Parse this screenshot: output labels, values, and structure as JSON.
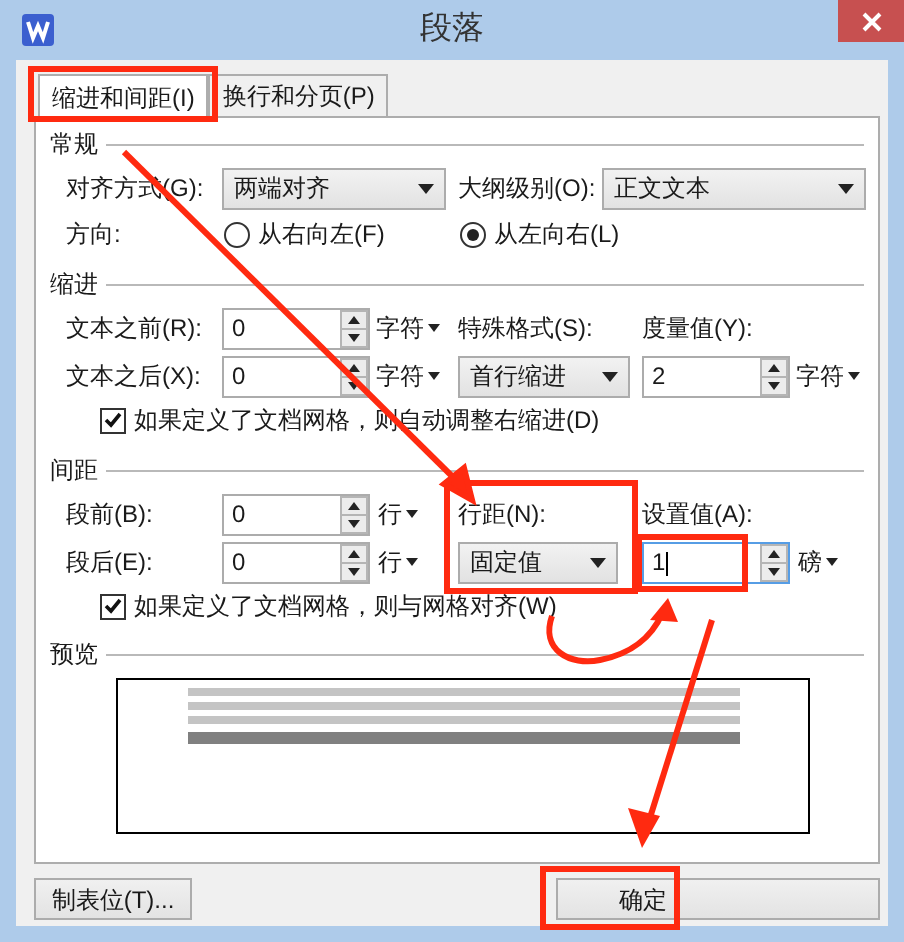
{
  "window": {
    "title": "段落"
  },
  "tabs": [
    {
      "label": "缩进和间距(I)",
      "selected": true,
      "highlighted": true
    },
    {
      "label": "换行和分页(P)",
      "selected": false,
      "highlighted": false
    }
  ],
  "general": {
    "heading": "常规",
    "alignment": {
      "label": "对齐方式(G):",
      "value": "两端对齐"
    },
    "outline_level": {
      "label": "大纲级别(O):",
      "value": "正文文本"
    },
    "direction": {
      "label": "方向:",
      "options": [
        {
          "label": "从右向左(F)",
          "selected": false
        },
        {
          "label": "从左向右(L)",
          "selected": true
        }
      ]
    }
  },
  "indent": {
    "heading": "缩进",
    "rows": [
      {
        "label": "文本之前(R):",
        "value": "0",
        "unit": "字符"
      },
      {
        "label": "文本之后(X):",
        "value": "0",
        "unit": "字符"
      }
    ],
    "special": {
      "label": "特殊格式(S):",
      "value": "首行缩进"
    },
    "measure": {
      "label": "度量值(Y):",
      "value": "2",
      "unit": "字符"
    },
    "auto_adjust": {
      "label": "如果定义了文档网格，则自动调整右缩进(D)",
      "checked": true
    }
  },
  "spacing": {
    "heading": "间距",
    "rows": [
      {
        "label": "段前(B):",
        "value": "0",
        "unit": "行"
      },
      {
        "label": "段后(E):",
        "value": "0",
        "unit": "行"
      }
    ],
    "line_spacing": {
      "label": "行距(N):",
      "value": "固定值",
      "highlighted": true
    },
    "set_value": {
      "label": "设置值(A):",
      "value": "1",
      "unit": "磅",
      "focused": true,
      "highlighted": true
    },
    "snap_to_grid": {
      "label": "如果定义了文档网格，则与网格对齐(W)",
      "checked": true
    }
  },
  "preview": {
    "heading": "预览"
  },
  "buttons": [
    {
      "label": "制表位(T)...",
      "kind": "tabs",
      "highlighted": false
    },
    {
      "label": "确定",
      "kind": "ok",
      "highlighted": true
    }
  ]
}
